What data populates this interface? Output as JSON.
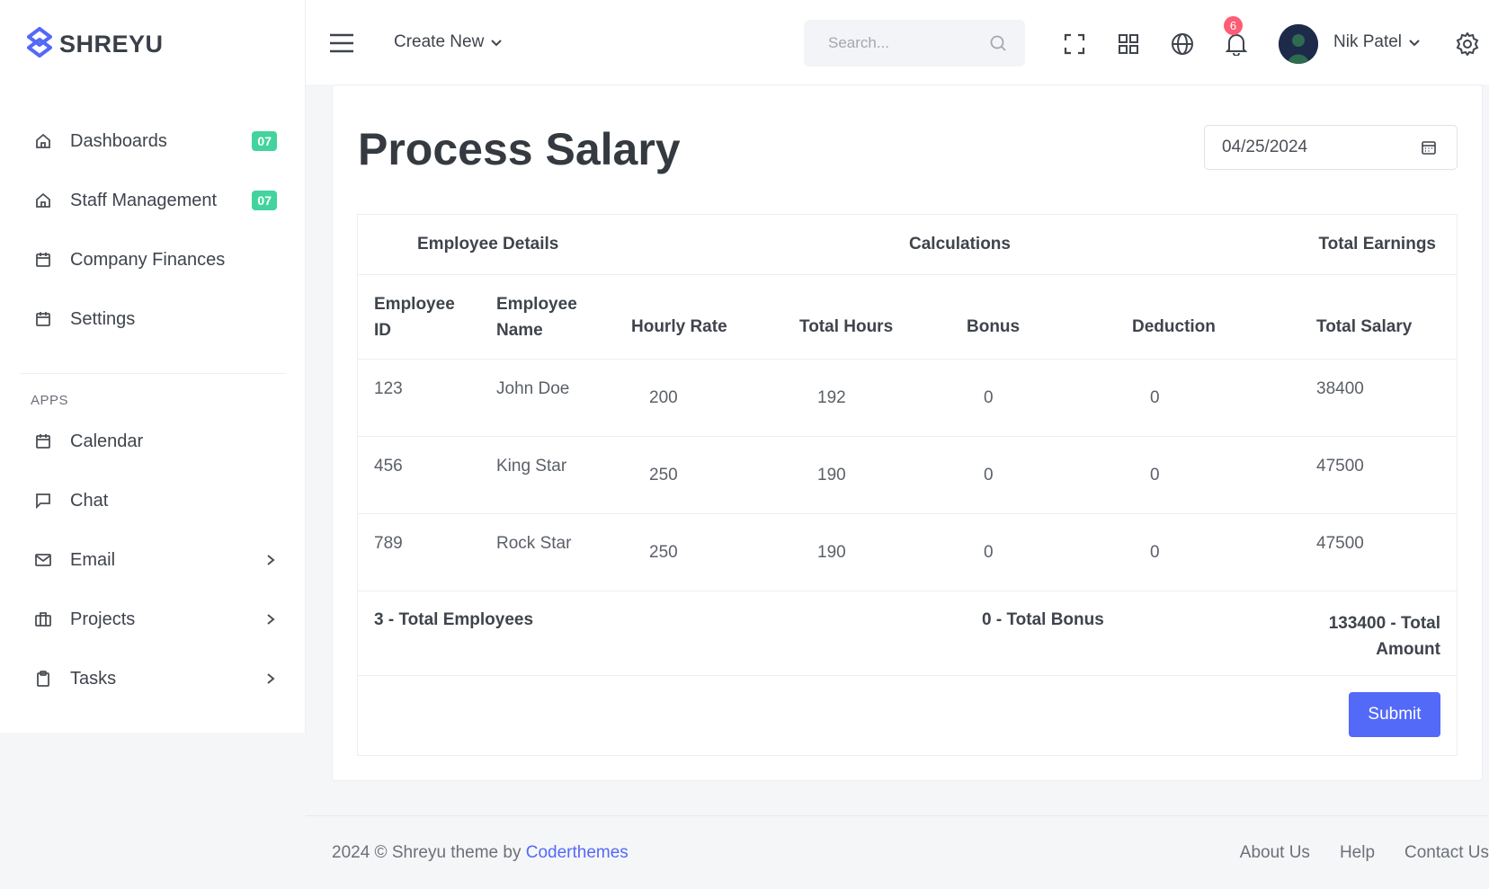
{
  "brand": {
    "name": "SHREYU",
    "color": "#5369f8"
  },
  "sidebar": {
    "items": [
      {
        "label": "Dashboards",
        "icon": "home-icon",
        "badge": "07"
      },
      {
        "label": "Staff Management",
        "icon": "home-icon",
        "badge": "07"
      },
      {
        "label": "Company Finances",
        "icon": "calendar-icon"
      },
      {
        "label": "Settings",
        "icon": "calendar-icon"
      }
    ],
    "apps_title": "APPS",
    "apps": [
      {
        "label": "Calendar",
        "icon": "calendar-icon"
      },
      {
        "label": "Chat",
        "icon": "chat-icon"
      },
      {
        "label": "Email",
        "icon": "mail-icon"
      },
      {
        "label": "Projects",
        "icon": "briefcase-icon"
      },
      {
        "label": "Tasks",
        "icon": "clipboard-icon"
      }
    ]
  },
  "topbar": {
    "create_new": "Create New",
    "search_placeholder": "Search...",
    "notification_count": "6",
    "user_name": "Nik Patel"
  },
  "page": {
    "title": "Process Salary",
    "date": "04/25/2024"
  },
  "table": {
    "group_headers": {
      "employee_details": "Employee Details",
      "calculations": "Calculations",
      "total_earnings": "Total Earnings"
    },
    "columns": {
      "employee_id": "Employee ID",
      "employee_name": "Employee Name",
      "hourly_rate": "Hourly Rate",
      "total_hours": "Total Hours",
      "bonus": "Bonus",
      "deduction": "Deduction",
      "total_salary": "Total Salary"
    },
    "rows": [
      {
        "id": "123",
        "name": "John Doe",
        "rate": "200",
        "hours": "192",
        "bonus": "0",
        "deduction": "0",
        "salary": "38400"
      },
      {
        "id": "456",
        "name": "King Star",
        "rate": "250",
        "hours": "190",
        "bonus": "0",
        "deduction": "0",
        "salary": "47500"
      },
      {
        "id": "789",
        "name": "Rock Star",
        "rate": "250",
        "hours": "190",
        "bonus": "0",
        "deduction": "0",
        "salary": "47500"
      }
    ],
    "summary": {
      "total_employees": "3 - Total Employees",
      "total_bonus": "0 - Total Bonus",
      "total_amount": "133400 - Total Amount"
    },
    "submit_label": "Submit"
  },
  "footer": {
    "copyright": "2024 © Shreyu theme by ",
    "author": "Coderthemes",
    "links": [
      "About Us",
      "Help",
      "Contact Us"
    ]
  }
}
